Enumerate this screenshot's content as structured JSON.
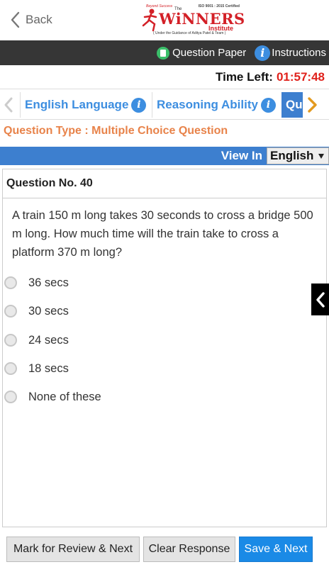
{
  "header": {
    "back_label": "Back",
    "logo": {
      "brand": "WiNNERS",
      "the": "The",
      "institute": "Institute",
      "iso": "ISO 9001 : 2015 Certified",
      "under": "( Under the Guidance of Aditya Patel & Team )",
      "tagline": "Beyond Success"
    }
  },
  "toolbar": {
    "question_paper_label": "Question Paper",
    "instructions_label": "Instructions"
  },
  "timer": {
    "label": "Time Left:",
    "value": "01:57:48"
  },
  "sections": [
    {
      "label": "English Language",
      "active": false
    },
    {
      "label": "Reasoning Ability",
      "active": false
    },
    {
      "label": "Qu",
      "active": true
    }
  ],
  "question_type": "Question Type : Multiple Choice Question",
  "view": {
    "label": "View In",
    "language": "English"
  },
  "question": {
    "number_label": "Question No. 40",
    "text": "A train 150 m long takes 30 seconds to cross a bridge 500 m long. How much time will the train take to cross a platform 370 m long?",
    "options": [
      "36 secs",
      "30 secs",
      "24 secs",
      "18 secs",
      "None of these"
    ]
  },
  "actions": {
    "mark_review": "Mark for Review & Next",
    "clear": "Clear Response",
    "save_next": "Save & Next"
  },
  "colors": {
    "accent_blue": "#3d7fcf",
    "timer_red": "#e0211b",
    "question_type_orange": "#e8834a",
    "save_button": "#1a8ae6"
  }
}
